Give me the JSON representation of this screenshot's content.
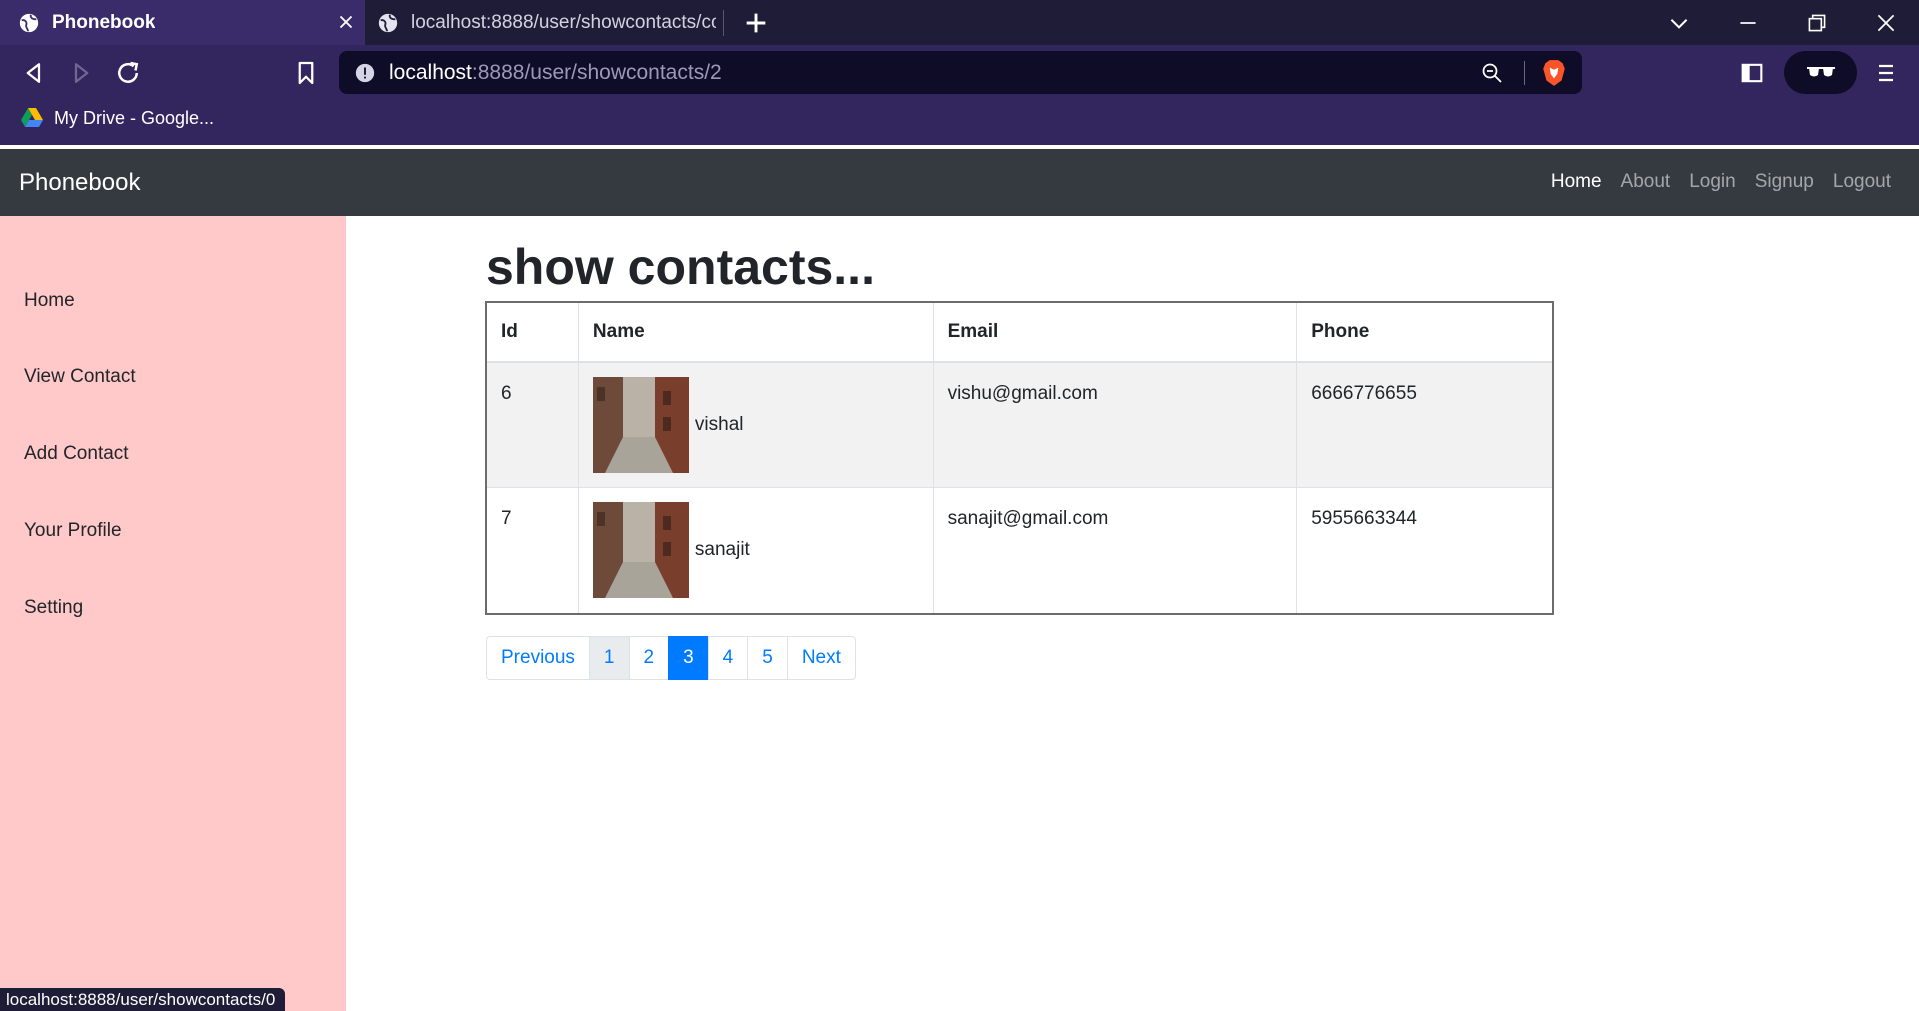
{
  "browser": {
    "tabs": [
      {
        "title": "Phonebook",
        "active": true
      },
      {
        "title": "localhost:8888/user/showcontacts/con",
        "active": false
      }
    ],
    "url": {
      "host": "localhost",
      "path": ":8888/user/showcontacts/2"
    },
    "bookmarks": [
      {
        "label": "My Drive - Google..."
      }
    ],
    "status_url": "localhost:8888/user/showcontacts/0"
  },
  "site": {
    "brand": "Phonebook",
    "nav_links": [
      "Home",
      "About",
      "Login",
      "Signup",
      "Logout"
    ],
    "active_nav": "Home"
  },
  "sidebar": {
    "items": [
      "Home",
      "View Contact",
      "Add Contact",
      "Your Profile",
      "Setting"
    ]
  },
  "main": {
    "heading": "show contacts...",
    "table": {
      "headers": [
        "Id",
        "Name",
        "Email",
        "Phone"
      ],
      "rows": [
        {
          "id": "6",
          "name": "vishal",
          "email": "vishu@gmail.com",
          "phone": "6666776655"
        },
        {
          "id": "7",
          "name": "sanajit",
          "email": "sanajit@gmail.com",
          "phone": "5955663344"
        }
      ]
    },
    "pagination": {
      "previous": "Previous",
      "pages": [
        "1",
        "2",
        "3",
        "4",
        "5"
      ],
      "active_page": "3",
      "next": "Next"
    }
  },
  "colors": {
    "tab_strip": "#1f1c37",
    "browser_toolbar": "#33265f",
    "site_navbar": "#343a40",
    "sidebar": "#ffc9c9",
    "accent": "#007bff"
  }
}
